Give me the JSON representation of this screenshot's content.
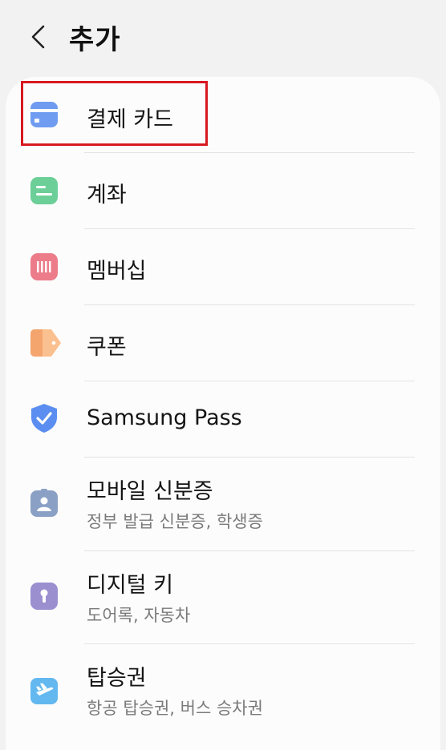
{
  "header": {
    "title": "추가",
    "back_icon": "chevron-left-icon"
  },
  "items": [
    {
      "title": "결제 카드",
      "icon": "payment-card-icon",
      "color": "#6f9cf0"
    },
    {
      "title": "계좌",
      "icon": "bank-account-icon",
      "color": "#6ccf97"
    },
    {
      "title": "멤버십",
      "icon": "membership-barcode-icon",
      "color": "#ec7c8a"
    },
    {
      "title": "쿠폰",
      "icon": "coupon-tag-icon",
      "color": "#f4a56e"
    },
    {
      "title": "Samsung Pass",
      "icon": "shield-check-icon",
      "color": "#5b8ef0"
    },
    {
      "title": "모바일 신분증",
      "subtitle": "정부 발급 신분증, 학생증",
      "icon": "id-badge-icon",
      "color": "#8aa0c4"
    },
    {
      "title": "디지털 키",
      "subtitle": "도어록, 자동차",
      "icon": "key-lock-icon",
      "color": "#9b8fd0"
    },
    {
      "title": "탑승권",
      "subtitle": "항공 탑승권, 버스 승차권",
      "icon": "boarding-pass-plane-icon",
      "color": "#63b8ef"
    }
  ],
  "highlight_color": "#d71920"
}
